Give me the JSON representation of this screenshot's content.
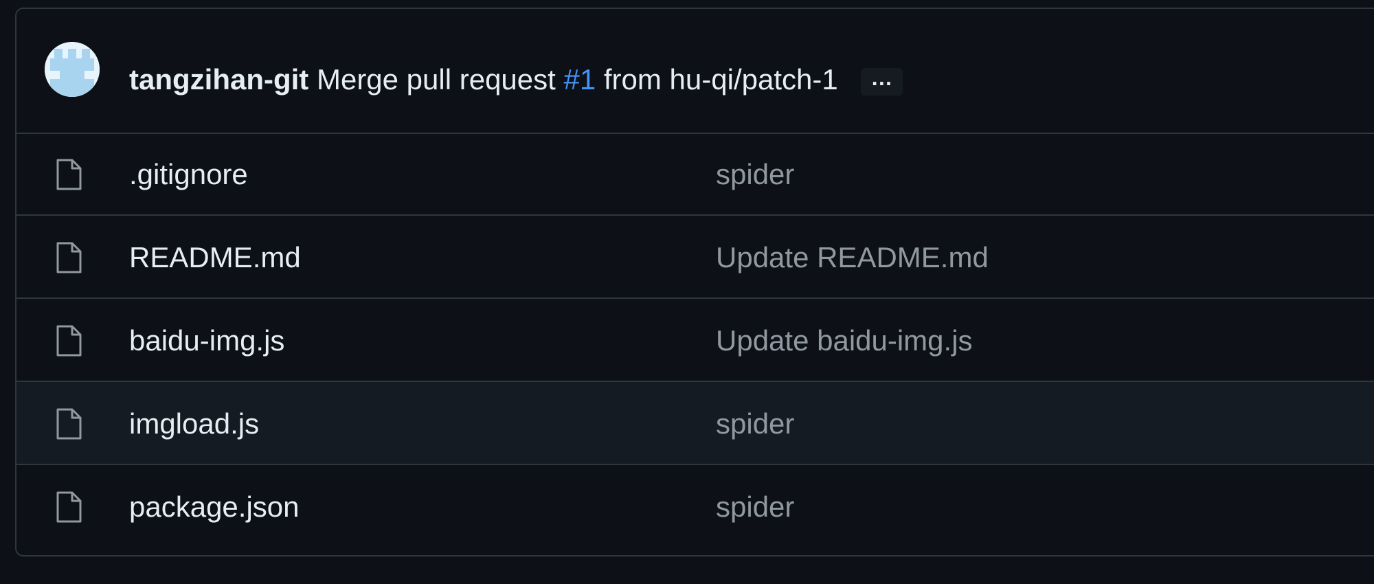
{
  "latest_commit": {
    "author": "tangzihan-git",
    "message_prefix": "Merge pull request",
    "pr_number": "#1",
    "message_suffix": "from hu-qi/patch-1",
    "more_label": "…"
  },
  "files": [
    {
      "name": ".gitignore",
      "commit_message": "spider",
      "icon": "file-icon"
    },
    {
      "name": "README.md",
      "commit_message": "Update README.md",
      "icon": "file-icon"
    },
    {
      "name": "baidu-img.js",
      "commit_message": "Update baidu-img.js",
      "icon": "file-icon"
    },
    {
      "name": "imgload.js",
      "commit_message": "spider",
      "icon": "file-icon"
    },
    {
      "name": "package.json",
      "commit_message": "spider",
      "icon": "file-icon"
    }
  ],
  "colors": {
    "background": "#0d1117",
    "border": "#30363d",
    "text": "#e6edf3",
    "muted": "#9198a1",
    "link": "#4493f8",
    "row_hover": "#151b23"
  }
}
